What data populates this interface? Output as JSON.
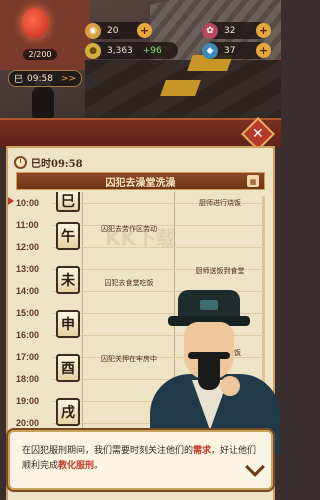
{
  "hud": {
    "prison_count": "2/200",
    "resources": {
      "food": "20",
      "flower": "32",
      "coins": "3,363",
      "coins_rate": "+96",
      "water": "37"
    },
    "time": "09:58",
    "time_icon": "巳",
    "speed_icon": ">>"
  },
  "panel": {
    "header": "巳时09:58",
    "active_banner": "囚犯去澡堂洗澡",
    "times": [
      "10:00",
      "11:00",
      "12:00",
      "13:00",
      "14:00",
      "15:00",
      "16:00",
      "17:00",
      "18:00",
      "19:00",
      "20:00"
    ],
    "shichen": [
      "巳",
      "午",
      "未",
      "申",
      "酉",
      "戌"
    ],
    "tasks_left": [
      "囚犯去劳作区劳动",
      "囚犯去食堂吃饭",
      "囚犯关押在牢房中"
    ],
    "tasks_right": [
      "厨师进行烧饭",
      "厨师送饭到食堂",
      "厨师进行烧饭"
    ],
    "watermark": "KK下载"
  },
  "dialog": {
    "part1": "在囚犯服刑期间，我们需要时刻关注他们的",
    "highlight1": "需求",
    "part2": "，好让他们顺利完成",
    "highlight2": "教化服刑",
    "part3": "。"
  },
  "colors": {
    "accent": "#c0392b",
    "panel_bg": "#efe3c6",
    "banner": "#8b4a27"
  }
}
